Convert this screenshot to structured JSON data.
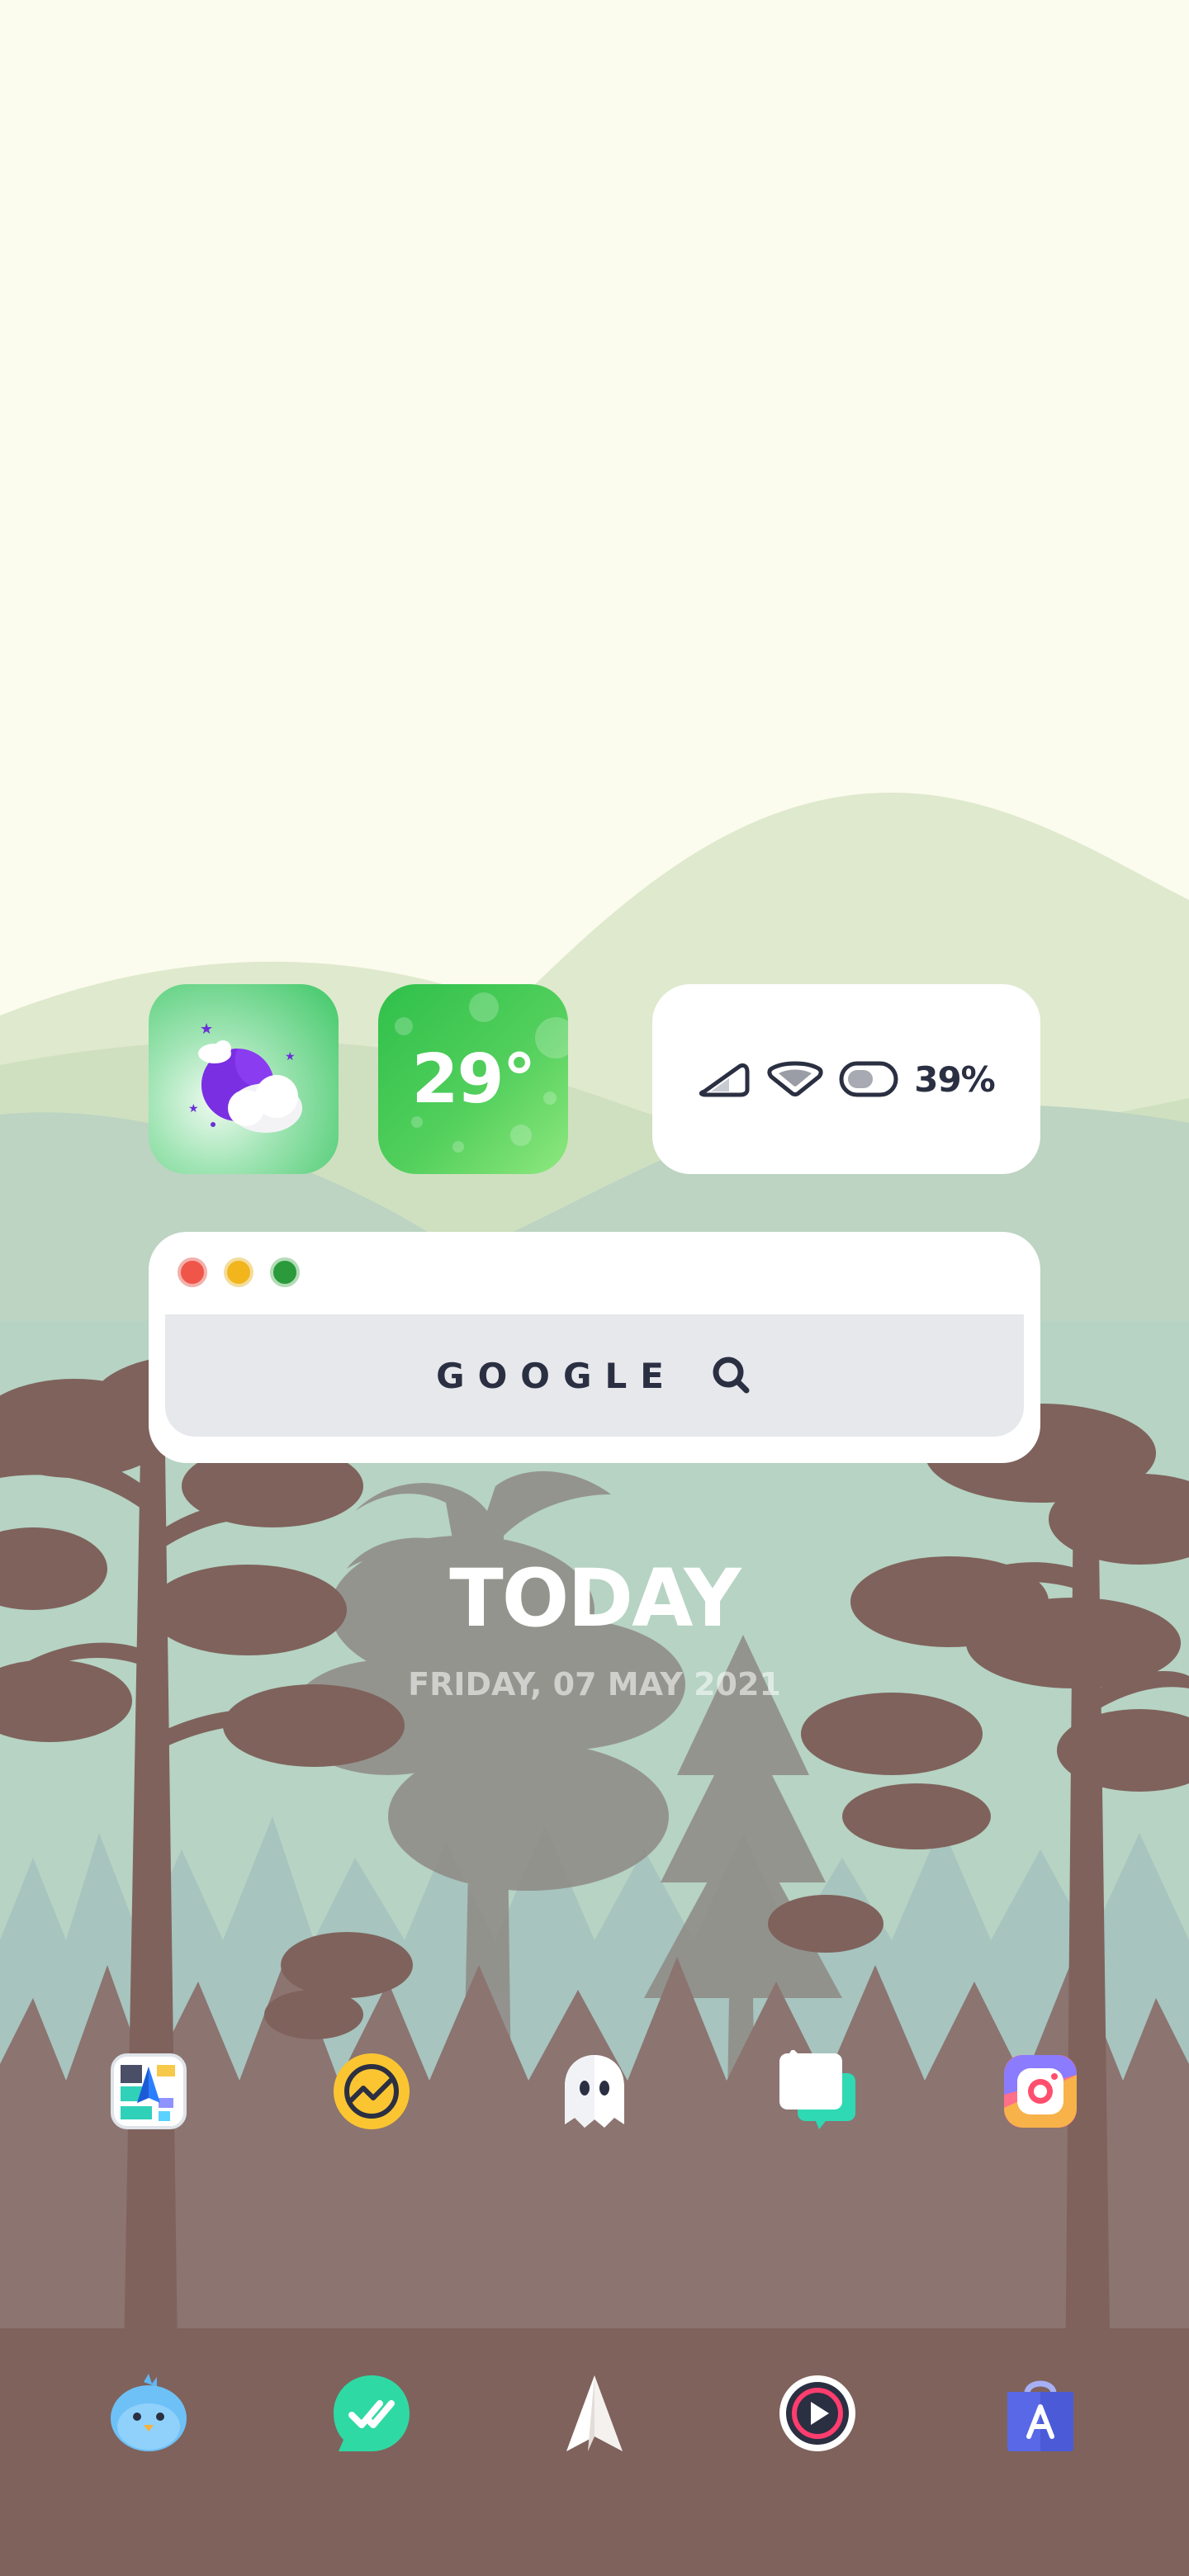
{
  "weather": {
    "temperature": "29°",
    "condition_icon": "night-cloud-icon"
  },
  "status": {
    "battery_percent": "39%",
    "icons": [
      "signal-icon",
      "wifi-icon",
      "battery-toggle-icon"
    ]
  },
  "search": {
    "label": "GOOGLE",
    "icon": "search-icon",
    "window_buttons": [
      "close",
      "minimize",
      "maximize"
    ]
  },
  "date_widget": {
    "title": "TODAY",
    "date": "FRIDAY, 07 MAY 2021"
  },
  "apps_row": [
    {
      "name": "maps-app",
      "icon": "map-icon"
    },
    {
      "name": "basecamp-app",
      "icon": "basecamp-icon"
    },
    {
      "name": "ghost-app",
      "icon": "ghost-icon"
    },
    {
      "name": "chat-app",
      "icon": "chat-bubbles-icon"
    },
    {
      "name": "instagram-app",
      "icon": "camera-icon"
    }
  ],
  "dock": [
    {
      "name": "bird-app",
      "icon": "bird-icon"
    },
    {
      "name": "tasks-app",
      "icon": "double-check-chat-icon"
    },
    {
      "name": "paper-plane-app",
      "icon": "paper-plane-icon"
    },
    {
      "name": "music-player-app",
      "icon": "play-circle-icon"
    },
    {
      "name": "app-store-app",
      "icon": "shopping-bag-icon"
    }
  ],
  "colors": {
    "sky": "#fbfbee",
    "hills_back": "#dfe9cd",
    "hills_mid": "#cfe0c0",
    "hills_front": "#bdd5c0",
    "forest_bg": "#b5d3c2",
    "trees": "#7f625c",
    "ground": "#7f625c",
    "text_dark": "#2b2f42"
  }
}
